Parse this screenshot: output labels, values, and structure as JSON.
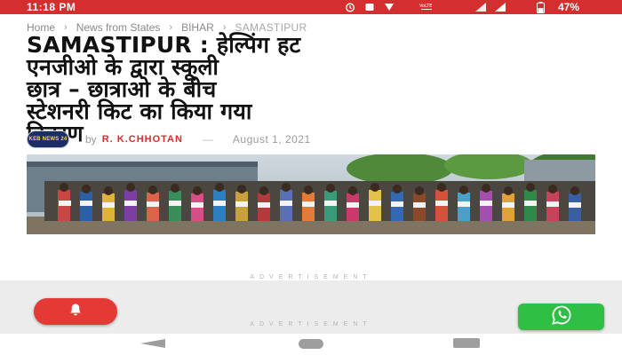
{
  "status_bar": {
    "time": "11:18 PM",
    "battery": "47%",
    "background_color": "#d32f2f",
    "icons": [
      "alarm-icon",
      "notification-icon",
      "sound-icon",
      "volte-icon",
      "wifi-icon",
      "signal-icon",
      "battery-icon"
    ]
  },
  "breadcrumb": {
    "items": [
      "Home",
      "News from States",
      "BIHAR",
      "SAMASTIPUR"
    ]
  },
  "article": {
    "title_lines": [
      "SAMASTIPUR : हेल्पिंग हट",
      "एनजीओ के द्वारा स्कूली",
      "छात्र – छात्राओ के बीच",
      "स्टेशनरी किट का किया गया",
      "वितरण"
    ],
    "avatar_text": "KEB NEWS 24",
    "by_label": "by",
    "author": "R. K.CHHOTAN",
    "separator": "—",
    "date": "August 1, 2021",
    "accent_color": "#d32f2f"
  },
  "advertisement": {
    "label_top": "ADVERTISEMENT",
    "label_bottom": "ADVERTISEMENT"
  },
  "floating_buttons": {
    "alert_icon": "bell-icon",
    "alert_color": "#e53935",
    "whatsapp_icon": "whatsapp-icon",
    "whatsapp_color": "#2fbf44"
  },
  "nav_bar": {
    "buttons": [
      "back",
      "home",
      "recents"
    ]
  }
}
